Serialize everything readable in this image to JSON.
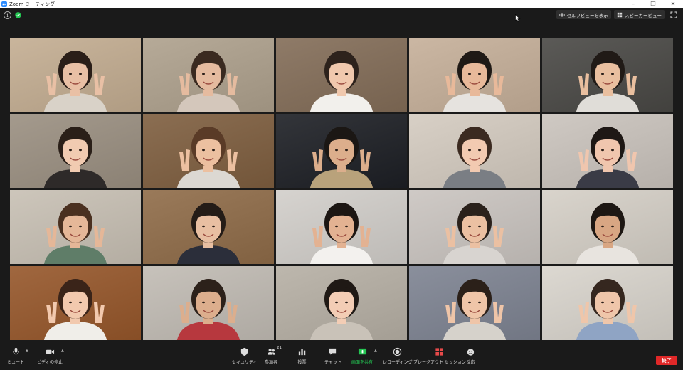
{
  "window": {
    "title": "Zoom ミーティング",
    "minimize": "–",
    "maximize": "❐",
    "close": "✕"
  },
  "header": {
    "info_glyph": "i",
    "self_view_label": "セルフビューを表示",
    "speaker_view_label": "スピーカービュー"
  },
  "participant_count": "21",
  "toolbar": {
    "mute": "ミュート",
    "stop_video": "ビデオの停止",
    "security": "セキュリティ",
    "participants": "参加者",
    "polls": "投票",
    "chat": "チャット",
    "share_screen": "画面を共有",
    "record": "レコーディング",
    "breakout": "ブレークアウト セッション",
    "reactions": "反応",
    "end": "終了"
  },
  "colors": {
    "accent_green": "#23c552",
    "end_red": "#e02828",
    "toolbar_bg": "#1a1a1a"
  },
  "tiles": [
    {
      "bg": "#c9b59c",
      "skin": "#e9c0a5",
      "hair": "#2a1e18",
      "shirt": "#d9d2c8"
    },
    {
      "bg": "#b6aa98",
      "skin": "#e5bb9f",
      "hair": "#3a2a20",
      "shirt": "#d4c7bb"
    },
    {
      "bg": "#8f7b68",
      "skin": "#f0c8ad",
      "hair": "#2d221c",
      "shirt": "#f2f0ec"
    },
    {
      "bg": "#cbb7a3",
      "skin": "#e8b99a",
      "hair": "#1f1915",
      "shirt": "#e6e3df"
    },
    {
      "bg": "#5b5a57",
      "skin": "#e9bf9f",
      "hair": "#201a16",
      "shirt": "#e0ddd8"
    },
    {
      "bg": "#a49a8d",
      "skin": "#f1cbb1",
      "hair": "#2a1f18",
      "shirt": "#2e2a29"
    },
    {
      "bg": "#8b6e52",
      "skin": "#ecc0a0",
      "hair": "#5a3b27",
      "shirt": "#dcd8d2"
    },
    {
      "bg": "#33353a",
      "skin": "#dcae8c",
      "hair": "#1b1714",
      "shirt": "#b9a27b"
    },
    {
      "bg": "#d8d0c6",
      "skin": "#f2cab1",
      "hair": "#3b2a20",
      "shirt": "#7a7e84"
    },
    {
      "bg": "#cfc9c3",
      "skin": "#f0c6ae",
      "hair": "#1e1815",
      "shirt": "#3a3b46"
    },
    {
      "bg": "#cdc6bb",
      "skin": "#e5b798",
      "hair": "#4a3020",
      "shirt": "#5f7d68"
    },
    {
      "bg": "#9a7a5a",
      "skin": "#e8bfa2",
      "hair": "#241c17",
      "shirt": "#2b2e3a"
    },
    {
      "bg": "#d6d3cf",
      "skin": "#e3b292",
      "hair": "#1c1613",
      "shirt": "#f3f1ee"
    },
    {
      "bg": "#cfcac6",
      "skin": "#ebc0a2",
      "hair": "#2a211b",
      "shirt": "#d8d4d0"
    },
    {
      "bg": "#d9d4cc",
      "skin": "#d8a683",
      "hair": "#1d1713",
      "shirt": "#e8e4df"
    },
    {
      "bg": "#a0673f",
      "skin": "#f2c9ae",
      "hair": "#3a2419",
      "shirt": "#f0eee9"
    },
    {
      "bg": "#c7c2bb",
      "skin": "#dcae8d",
      "hair": "#2c211a",
      "shirt": "#b7383e"
    },
    {
      "bg": "#bdb7ad",
      "skin": "#f3cdb5",
      "hair": "#1f1915",
      "shirt": "#c9c2b8"
    },
    {
      "bg": "#8a8f9c",
      "skin": "#efc5a8",
      "hair": "#2b2019",
      "shirt": "#d6d2cb"
    },
    {
      "bg": "#dcd8d1",
      "skin": "#efc6aa",
      "hair": "#35271f",
      "shirt": "#8fa4c4"
    }
  ]
}
